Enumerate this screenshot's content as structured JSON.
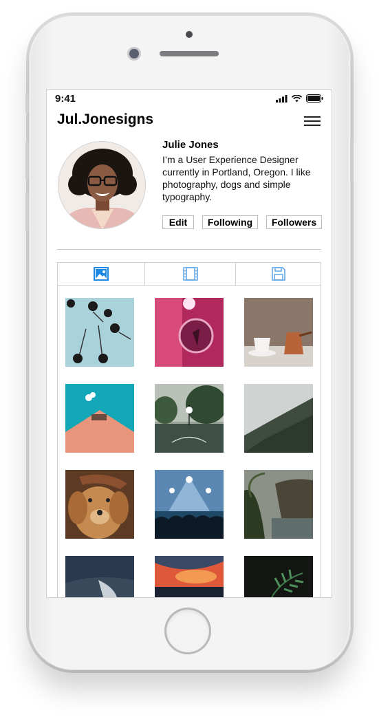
{
  "status_bar": {
    "time": "9:41"
  },
  "header": {
    "handle": "Jul.Jonesigns"
  },
  "profile": {
    "name": "Julie Jones",
    "bio": "I’m a User Experience Designer currently in Portland, Oregon. I like photography, dogs and simple typography.",
    "buttons": {
      "edit": "Edit",
      "following": "Following",
      "followers": "Followers"
    }
  },
  "tabs": [
    {
      "icon": "image-icon",
      "active": true
    },
    {
      "icon": "film-icon",
      "active": false
    },
    {
      "icon": "save-icon",
      "active": false
    }
  ],
  "photos": [
    {
      "icon": "palm-trees-photo"
    },
    {
      "icon": "neon-room-photo"
    },
    {
      "icon": "coffee-cups-photo"
    },
    {
      "icon": "pink-building-photo"
    },
    {
      "icon": "basketball-court-photo"
    },
    {
      "icon": "foggy-mountain-photo"
    },
    {
      "icon": "golden-retriever-photo"
    },
    {
      "icon": "concert-crowd-photo"
    },
    {
      "icon": "coastal-cliffs-photo"
    },
    {
      "icon": "night-sky-photo"
    },
    {
      "icon": "sunset-beach-photo"
    },
    {
      "icon": "fern-leaf-photo"
    }
  ],
  "colors": {
    "accent": "#1e88e5",
    "tab_icon_inactive": "#5ba4e6"
  }
}
